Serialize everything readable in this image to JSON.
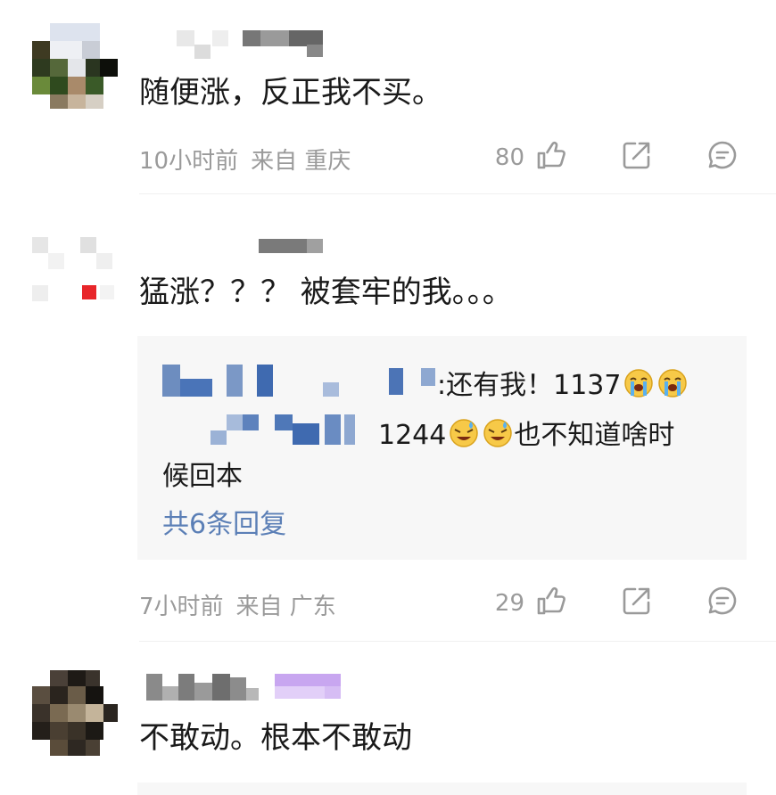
{
  "comments": [
    {
      "text": "随便涨，反正我不买。",
      "time": "10小时前",
      "source": "来自 重庆",
      "likes": "80"
    },
    {
      "text": "猛涨？？？ 被套牢的我。。。",
      "time": "7小时前",
      "source": "来自 广东",
      "likes": "29",
      "reply": {
        "line1_text": ":还有我！1137",
        "line2_text": "1244",
        "line2_suffix": "也不知道啥时",
        "line3_text": "候回本",
        "more": "共6条回复"
      }
    },
    {
      "text": "不敢动。根本不敢动"
    }
  ],
  "colors": {
    "meta": "#9a9a9a",
    "link": "#5b7fb6",
    "reply_bg": "#f7f7f7"
  },
  "icons": [
    "like-icon",
    "share-icon",
    "comment-icon",
    "crying-emoji",
    "sweat-smile-emoji"
  ]
}
